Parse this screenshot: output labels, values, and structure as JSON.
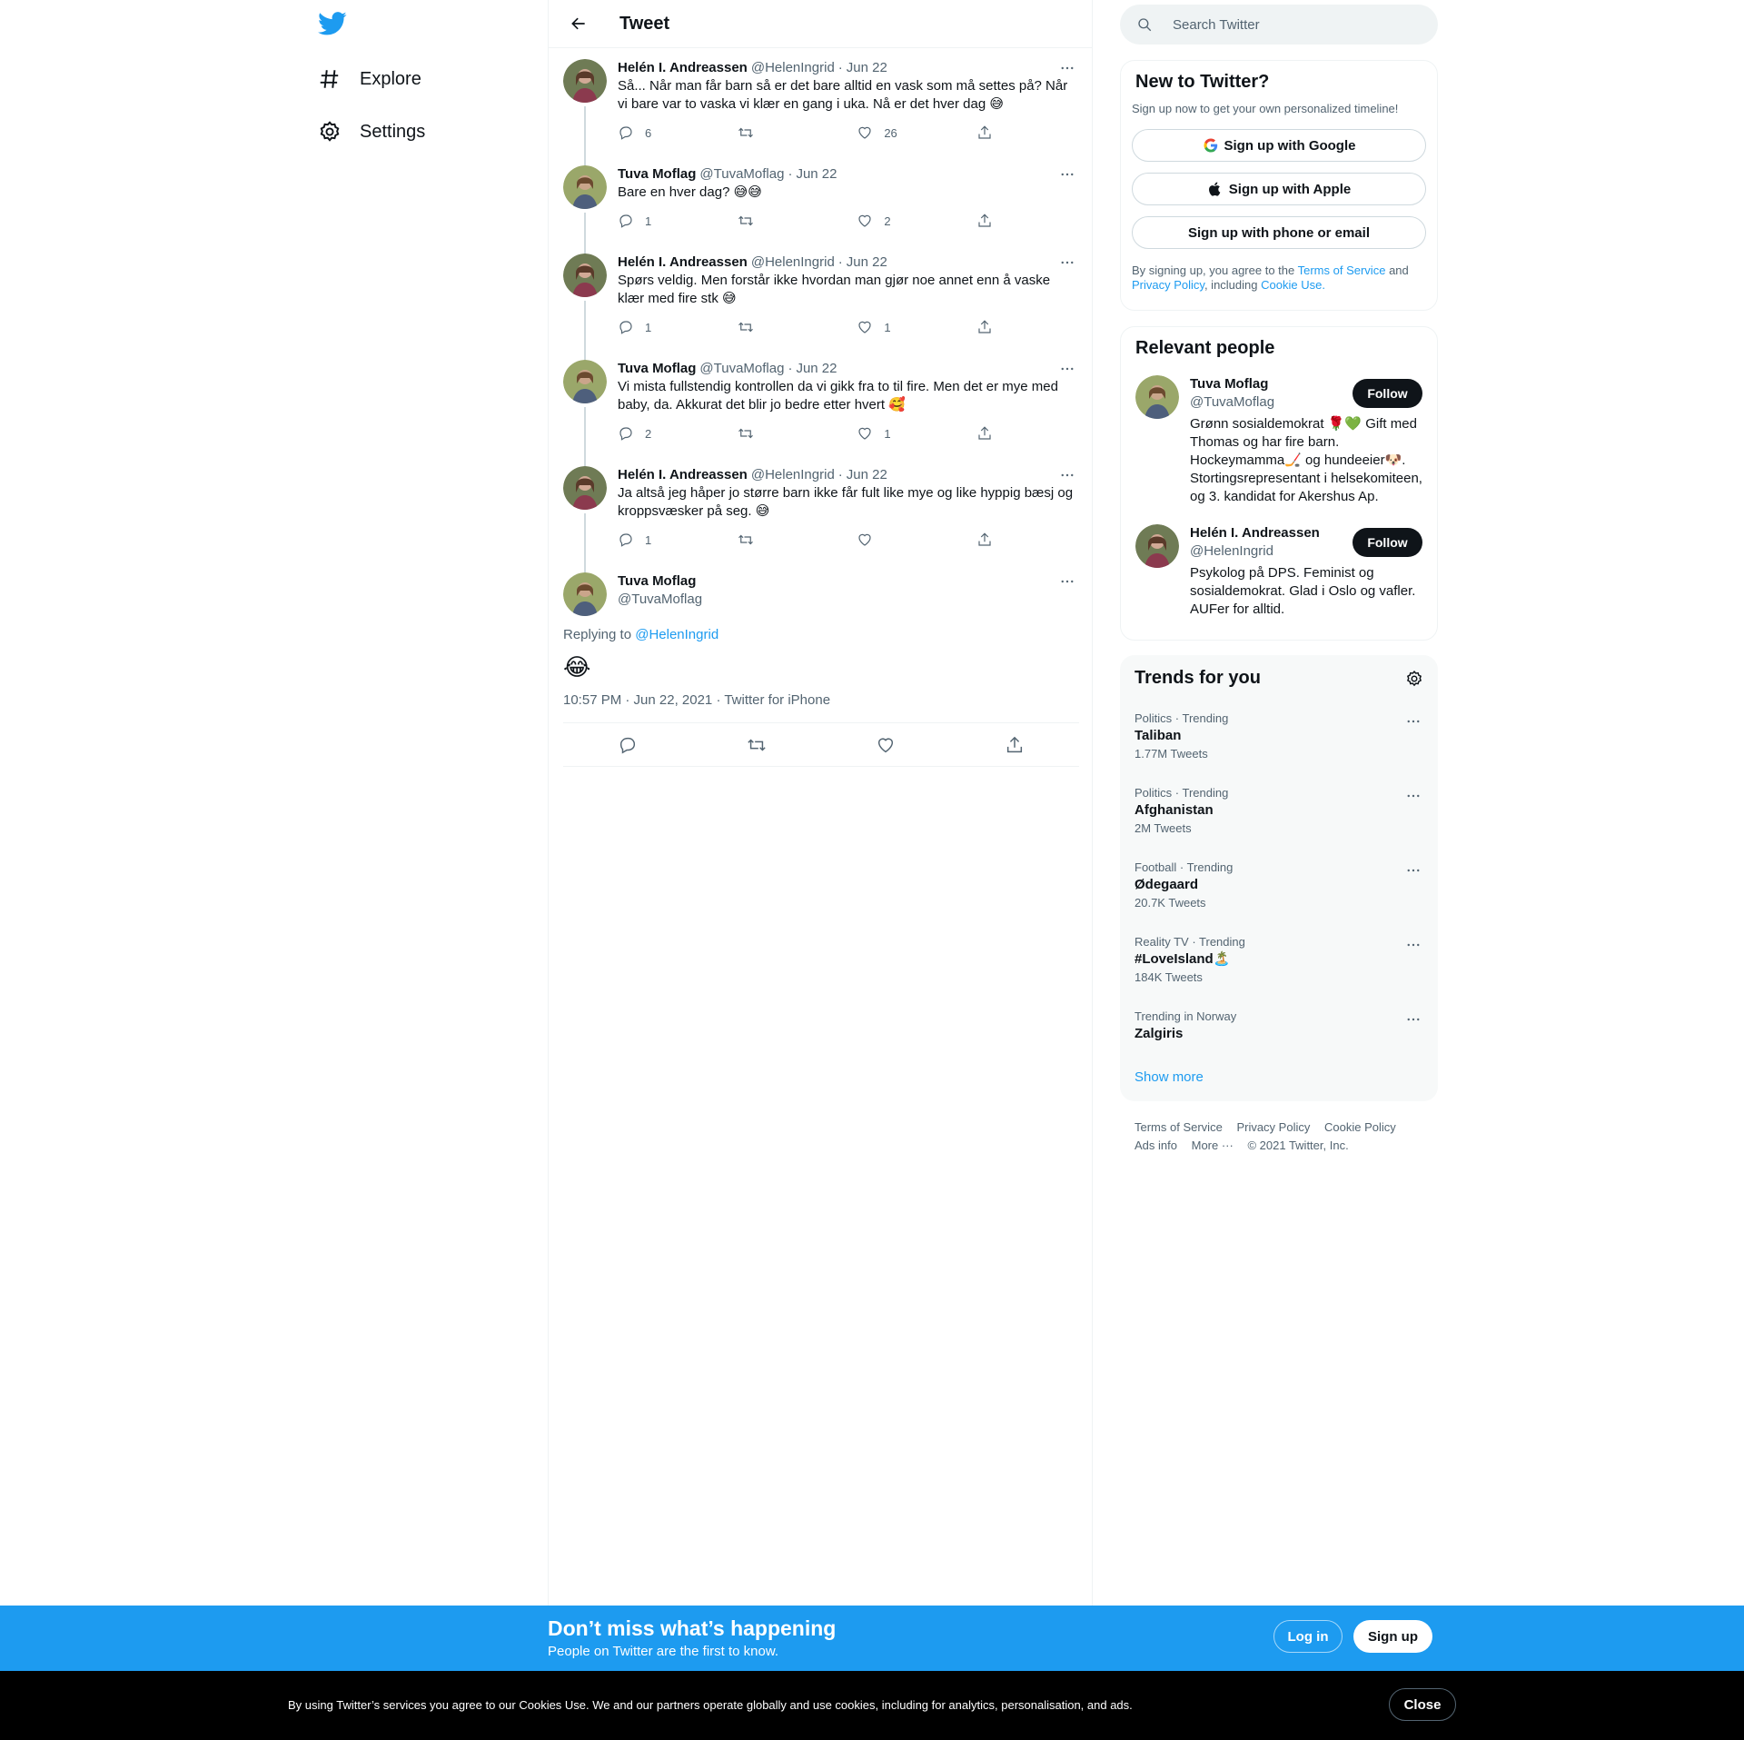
{
  "nav": {
    "logo": "twitter-bird-icon",
    "items": [
      {
        "label": "Explore",
        "icon": "hashtag-icon"
      },
      {
        "label": "Settings",
        "icon": "gear-icon"
      }
    ]
  },
  "header": {
    "title": "Tweet"
  },
  "thread": [
    {
      "name": "Helén I. Andreassen",
      "handle": "@HelenIngrid",
      "sep": "·",
      "date": "Jun 22",
      "text": "Så... Når man får barn så er det bare alltid en vask som må settes på? Når vi bare var to vaska vi klær en gang i uka. Nå er det hver dag 😅",
      "replies": "6",
      "retweets": "",
      "likes": "26"
    },
    {
      "name": "Tuva Moflag",
      "handle": "@TuvaMoflag",
      "sep": "·",
      "date": "Jun 22",
      "text": "Bare en hver dag? 😅😅",
      "replies": "1",
      "retweets": "",
      "likes": "2"
    },
    {
      "name": "Helén I. Andreassen",
      "handle": "@HelenIngrid",
      "sep": "·",
      "date": "Jun 22",
      "text": "Spørs veldig. Men forstår ikke hvordan man gjør noe annet enn å vaske klær med fire stk 😅",
      "replies": "1",
      "retweets": "",
      "likes": "1"
    },
    {
      "name": "Tuva Moflag",
      "handle": "@TuvaMoflag",
      "sep": "·",
      "date": "Jun 22",
      "text": "Vi mista fullstendig kontrollen da vi gikk fra to til fire. Men det er mye med baby, da. Akkurat det blir jo bedre etter hvert 🥰",
      "replies": "2",
      "retweets": "",
      "likes": "1"
    },
    {
      "name": "Helén I. Andreassen",
      "handle": "@HelenIngrid",
      "sep": "·",
      "date": "Jun 22",
      "text": "Ja altså jeg håper jo større barn ikke får fult like mye og like hyppig bæsj og kroppsvæsker på seg. 😅",
      "replies": "1",
      "retweets": "",
      "likes": ""
    }
  ],
  "main_tweet": {
    "name": "Tuva Moflag",
    "handle": "@TuvaMoflag",
    "replying_prefix": "Replying to",
    "replying_to": "@HelenIngrid",
    "text": "😂",
    "meta": "10:57 PM · Jun 22, 2021 · Twitter for iPhone"
  },
  "search": {
    "placeholder": "Search Twitter"
  },
  "new_to_twitter": {
    "title": "New to Twitter?",
    "subtitle": "Sign up now to get your own personalized timeline!",
    "google": "Sign up with Google",
    "apple": "Sign up with Apple",
    "phone": "Sign up with phone or email",
    "terms_1": "By signing up, you agree to the",
    "terms_link": "Terms of Service",
    "terms_2": "and",
    "privacy_link": "Privacy Policy",
    "terms_3": ", including",
    "cookie_link": "Cookie Use."
  },
  "relevant_people": {
    "title": "Relevant people",
    "people": [
      {
        "name": "Tuva Moflag",
        "handle": "@TuvaMoflag",
        "follow": "Follow",
        "bio": "Grønn sosialdemokrat 🌹💚 Gift med Thomas og har fire barn. Hockeymamma🏒 og hundeeier🐶. Stortingsrepresentant i helsekomiteen, og 3. kandidat for Akershus Ap."
      },
      {
        "name": "Helén I. Andreassen",
        "handle": "@HelenIngrid",
        "follow": "Follow",
        "bio": "Psykolog på DPS. Feminist og sosialdemokrat. Glad i Oslo og vafler. AUFer for alltid."
      }
    ]
  },
  "trends": {
    "title": "Trends for you",
    "items": [
      {
        "category": "Politics · Trending",
        "name": "Taliban",
        "count": "1.77M Tweets"
      },
      {
        "category": "Politics · Trending",
        "name": "Afghanistan",
        "count": "2M Tweets"
      },
      {
        "category": "Football · Trending",
        "name": "Ødegaard",
        "count": "20.7K Tweets"
      },
      {
        "category": "Reality TV · Trending",
        "name": "#LoveIsland🏝️",
        "count": "184K Tweets"
      },
      {
        "category": "Trending in Norway",
        "name": "Zalgiris",
        "count": ""
      }
    ],
    "show_more": "Show more"
  },
  "footer": {
    "links": [
      "Terms of Service",
      "Privacy Policy",
      "Cookie Policy",
      "Ads info",
      "More ···",
      "© 2021 Twitter, Inc."
    ]
  },
  "bottom_bar": {
    "title": "Don’t miss what’s happening",
    "subtitle": "People on Twitter are the first to know.",
    "login": "Log in",
    "signup": "Sign up"
  },
  "cookie_bar": {
    "text": "By using Twitter’s services you agree to our Cookies Use. We and our partners operate globally and use cookies, including for analytics, personalisation, and ads.",
    "close": "Close"
  },
  "colors": {
    "accent": "#1d9bf0",
    "text": "#0f1419",
    "muted": "#536471",
    "border": "#eff3f4"
  }
}
